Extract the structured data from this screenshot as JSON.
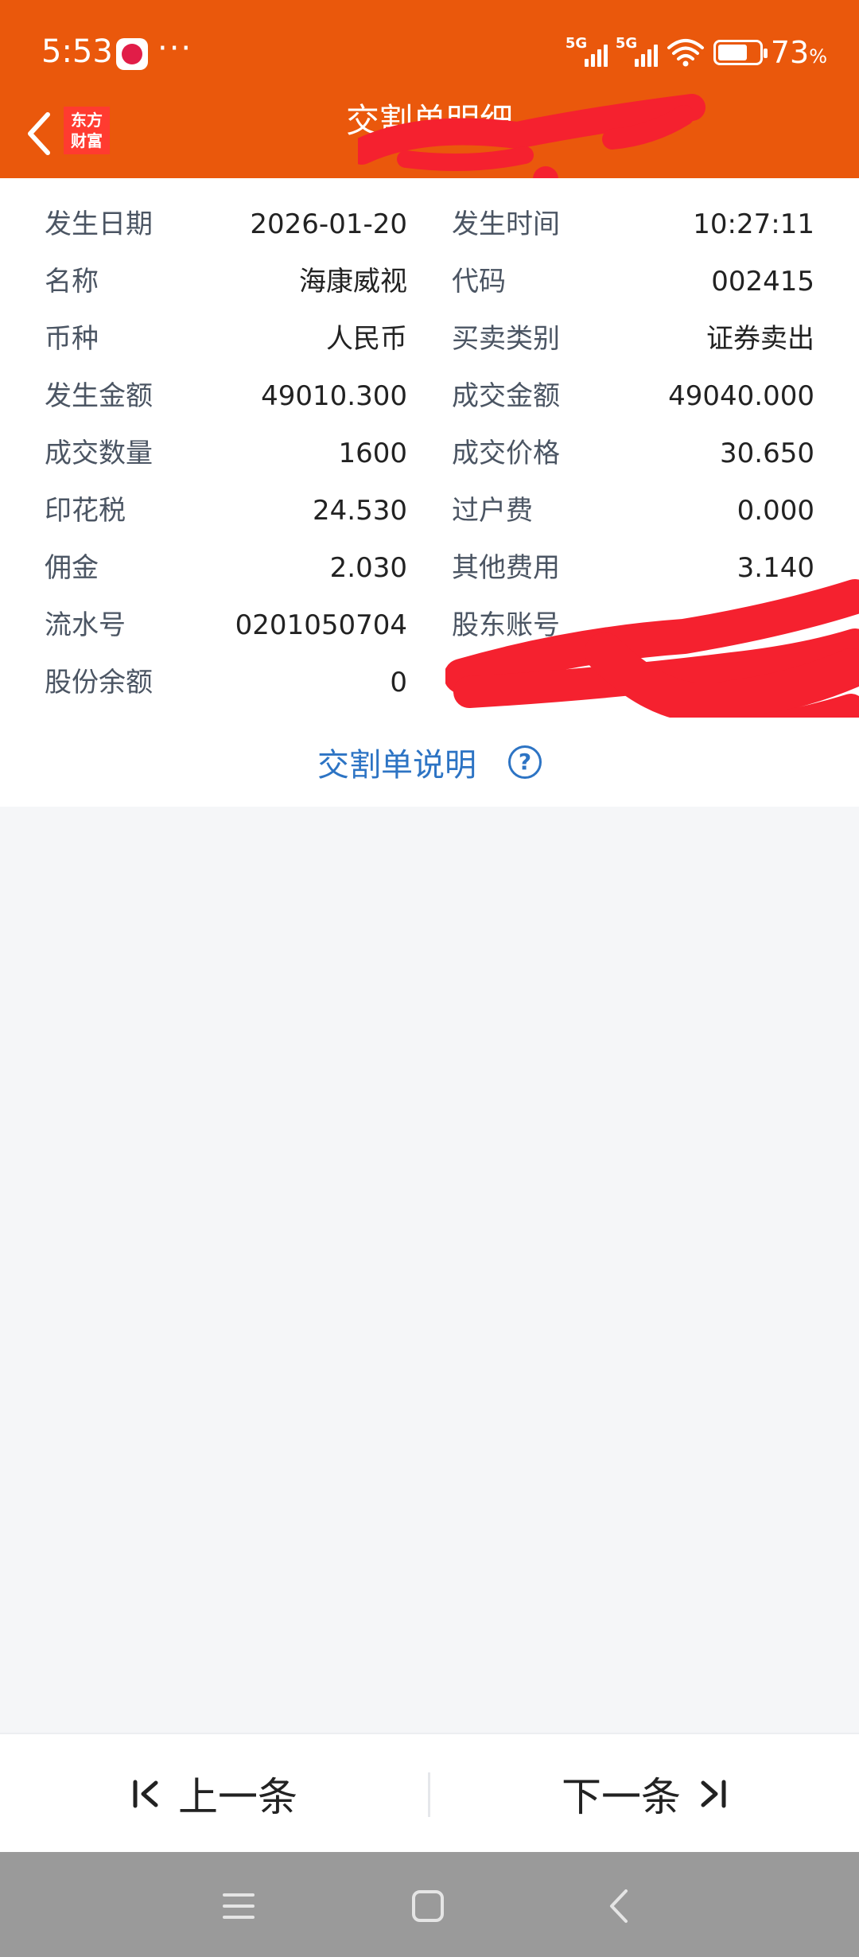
{
  "status_bar": {
    "time": "5:53",
    "more": "···",
    "signal1": "5G",
    "signal2": "5G",
    "battery_percent": "73",
    "battery_unit": "%",
    "battery_level": 0.73
  },
  "header": {
    "title": "交割单明细",
    "logo_line1": "东方",
    "logo_line2": "财富"
  },
  "details": [
    {
      "left_label": "发生日期",
      "left_value": "2026-01-20",
      "right_label": "发生时间",
      "right_value": "10:27:11"
    },
    {
      "left_label": "名称",
      "left_value": "海康威视",
      "right_label": "代码",
      "right_value": "002415"
    },
    {
      "left_label": "币种",
      "left_value": "人民币",
      "right_label": "买卖类别",
      "right_value": "证券卖出"
    },
    {
      "left_label": "发生金额",
      "left_value": "49010.300",
      "right_label": "成交金额",
      "right_value": "49040.000"
    },
    {
      "left_label": "成交数量",
      "left_value": "1600",
      "right_label": "成交价格",
      "right_value": "30.650"
    },
    {
      "left_label": "印花税",
      "left_value": "24.530",
      "right_label": "过户费",
      "right_value": "0.000"
    },
    {
      "left_label": "佣金",
      "left_value": "2.030",
      "right_label": "其他费用",
      "right_value": "3.140"
    },
    {
      "left_label": "流水号",
      "left_value": "0201050704",
      "right_label": "股东账号",
      "right_value": ""
    },
    {
      "left_label": "股份余额",
      "left_value": "0",
      "right_label": "",
      "right_value": ""
    }
  ],
  "explain": {
    "link": "交割单说明",
    "help": "?"
  },
  "bottom_nav": {
    "prev": "上一条",
    "next": "下一条",
    "prev_glyph": "I<",
    "next_glyph": ">I"
  },
  "colors": {
    "header_bg": "#ea580c",
    "link": "#2d74c4",
    "redaction": "#f5212f"
  }
}
